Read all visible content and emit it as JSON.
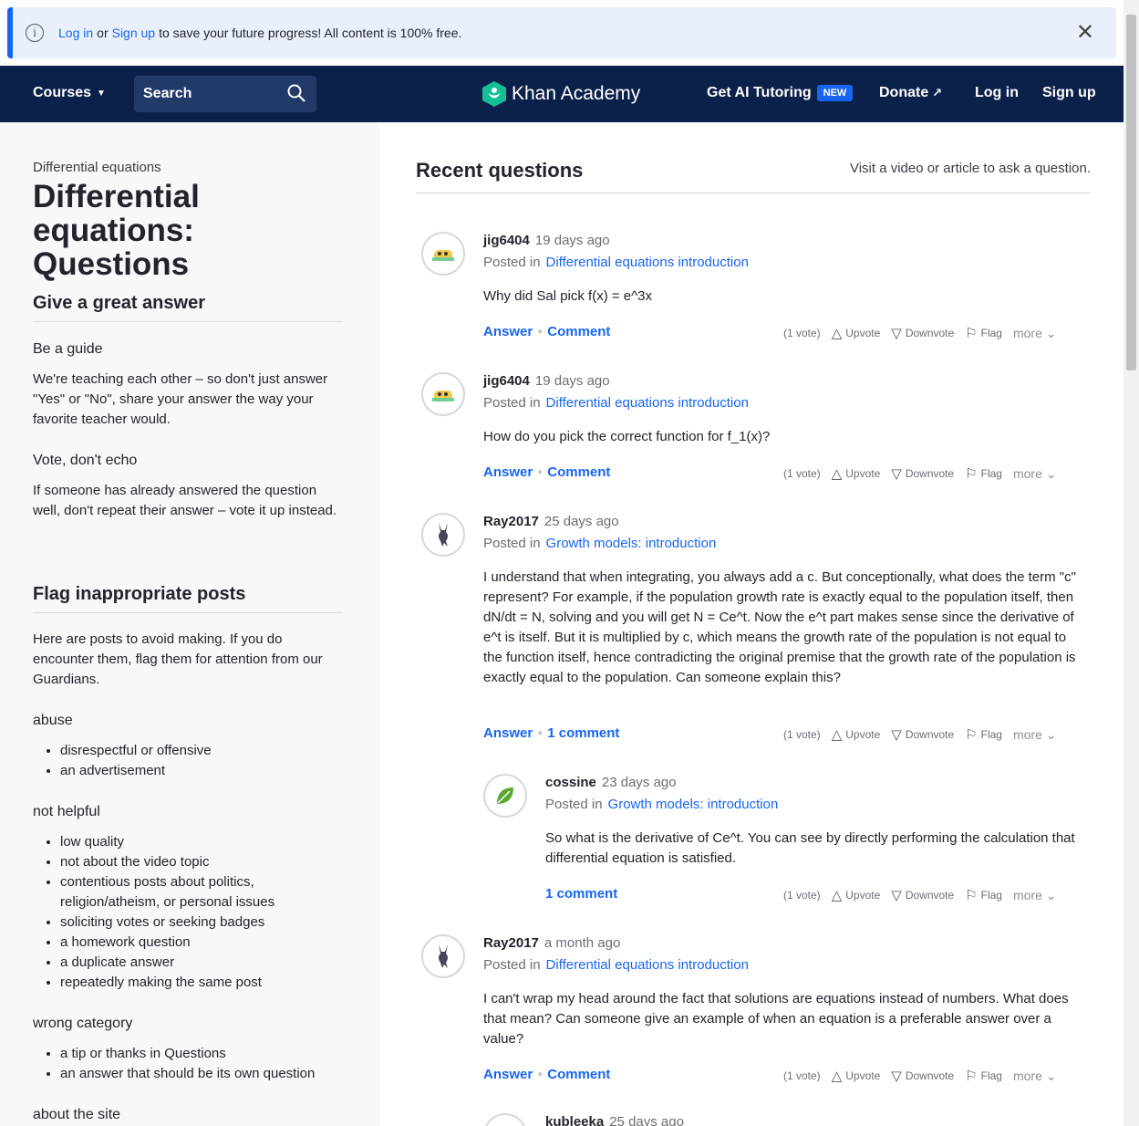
{
  "banner": {
    "login": "Log in",
    "or": "or",
    "signup": "Sign up",
    "message": "to save your future progress! All content is 100% free."
  },
  "header": {
    "courses": "Courses",
    "search_placeholder": "Search",
    "logo": "Khan Academy",
    "ai_tutoring": "Get AI Tutoring",
    "new_badge": "NEW",
    "donate": "Donate",
    "login": "Log in",
    "signup": "Sign up"
  },
  "sidebar": {
    "breadcrumb": "Differential equations",
    "title": "Differential equations: Questions",
    "give_answer": {
      "heading": "Give a great answer",
      "guide_title": "Be a guide",
      "guide_text": "We're teaching each other – so don't just answer \"Yes\" or \"No\", share your answer the way your favorite teacher would.",
      "vote_title": "Vote, don't echo",
      "vote_text": "If someone has already answered the question well, don't repeat their answer – vote it up instead."
    },
    "flag": {
      "heading": "Flag inappropriate posts",
      "intro": "Here are posts to avoid making. If you do encounter them, flag them for attention from our Guardians.",
      "abuse_title": "abuse",
      "abuse_items": [
        "disrespectful or offensive",
        "an advertisement"
      ],
      "nothelpful_title": "not helpful",
      "nothelpful_items": [
        "low quality",
        "not about the video topic",
        "contentious posts about politics, religion/atheism, or personal issues",
        "soliciting votes or seeking badges",
        "a homework question",
        "a duplicate answer",
        "repeatedly making the same post"
      ],
      "wrong_title": "wrong category",
      "wrong_items": [
        "a tip or thanks in Questions",
        "an answer that should be its own question"
      ],
      "about_title": "about the site"
    }
  },
  "main": {
    "title": "Recent questions",
    "hint": "Visit a video or article to ask a question.",
    "posted_in_label": "Posted in",
    "answer_label": "Answer",
    "vote_text": "(1 vote)",
    "upvote": "Upvote",
    "downvote": "Downvote",
    "flag": "Flag",
    "more": "more",
    "posts": [
      {
        "user": "jig6404",
        "time": "19 days ago",
        "topic": "Differential equations introduction",
        "body": "Why did Sal pick f(x) = e^3x",
        "comment": "Comment"
      },
      {
        "user": "jig6404",
        "time": "19 days ago",
        "topic": "Differential equations introduction",
        "body": "How do you pick the correct function for f_1(x)?",
        "comment": "Comment"
      },
      {
        "user": "Ray2017",
        "time": "25 days ago",
        "topic": "Growth models: introduction",
        "body": "I understand that when integrating, you always add a c. But conceptionally, what does the term \"c\" represent? For example, if the population growth rate is exactly equal to the population itself, then dN/dt = N, solving and you will get N = Ce^t. Now the e^t part makes sense since the derivative of e^t is itself. But it is multiplied by c, which means the growth rate of the population is not equal to the function itself, hence contradicting the original premise that the growth rate of the population is exactly equal to the population. Can someone explain this?",
        "comment": "1 comment"
      },
      {
        "user": "cossine",
        "time": "23 days ago",
        "topic": "Growth models: introduction",
        "body": "So what is the derivative of Ce^t. You can see by directly performing the calculation that differential equation is satisfied.",
        "comment": "1 comment"
      },
      {
        "user": "Ray2017",
        "time": "a month ago",
        "topic": "Differential equations introduction",
        "body": "I can't wrap my head around the fact that solutions are equations instead of numbers. What does that mean? Can someone give an example of when an equation is a preferable answer over a value?",
        "comment": "Comment"
      },
      {
        "user": "kubleeka",
        "time": "25 days ago"
      }
    ]
  }
}
